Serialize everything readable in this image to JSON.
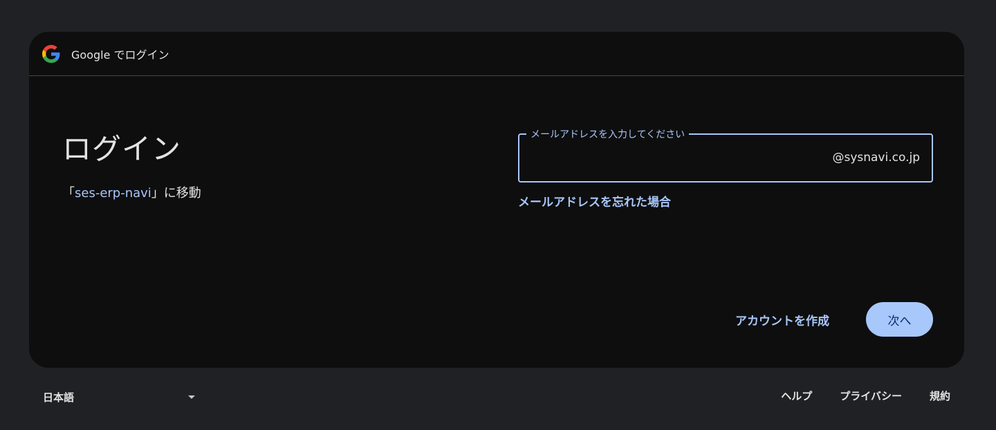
{
  "header": {
    "title": "Google でログイン",
    "logo_icon": "google-g-logo"
  },
  "main": {
    "title": "ログイン",
    "subtitle_prefix": "「",
    "app_name": "ses-erp-navi",
    "subtitle_suffix": "」に移動"
  },
  "email_field": {
    "label": "メールアドレスを入力してください",
    "value": "",
    "domain_suffix": "@sysnavi.co.jp"
  },
  "forgot_email_link": "メールアドレスを忘れた場合",
  "actions": {
    "create_account": "アカウントを作成",
    "next": "次へ"
  },
  "footer": {
    "language": "日本語",
    "links": [
      "ヘルプ",
      "プライバシー",
      "規約"
    ]
  },
  "colors": {
    "accent": "#a8c7fa",
    "card_background": "#0e0e0e",
    "page_background": "#202124",
    "next_button_text": "#062e6f"
  }
}
